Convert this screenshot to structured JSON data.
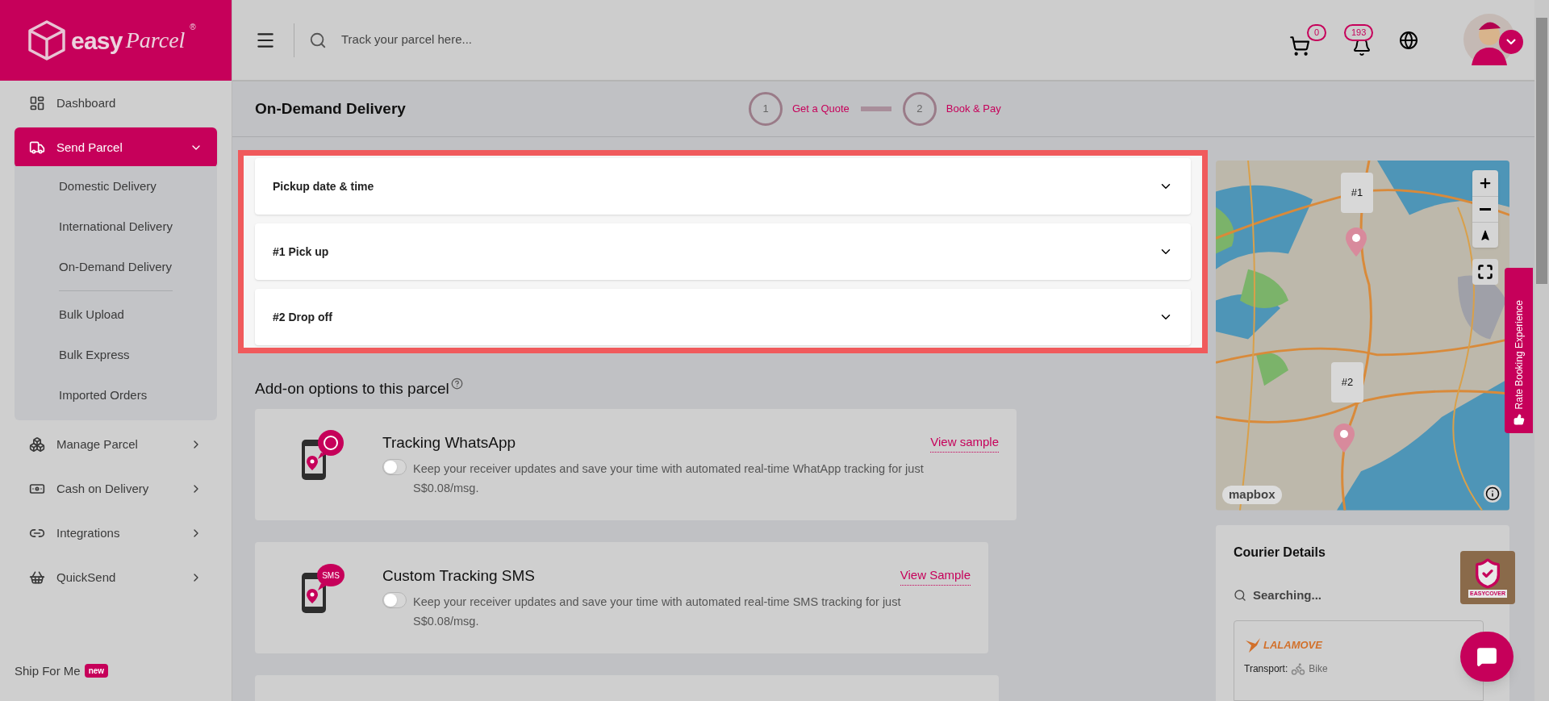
{
  "logo": {
    "word": "easy",
    "script": "Parcel",
    "mark": "®"
  },
  "topbar": {
    "search_placeholder": "Track your parcel here...",
    "cart_count": "0",
    "notification_count": "193"
  },
  "sidebar": {
    "items": [
      {
        "kind": "link",
        "label": "Dashboard",
        "selected": false
      },
      {
        "kind": "menu",
        "label": "Send Parcel",
        "selected": true,
        "expanded": true,
        "groups": [
          [
            {
              "label": "Domestic Delivery"
            },
            {
              "label": "International Delivery"
            },
            {
              "label": "On-Demand Delivery"
            }
          ],
          [
            {
              "label": "Bulk Upload"
            },
            {
              "label": "Bulk Express"
            },
            {
              "label": "Imported Orders"
            }
          ]
        ]
      },
      {
        "kind": "menu",
        "label": "Manage Parcel",
        "selected": false,
        "expanded": false
      },
      {
        "kind": "menu",
        "label": "Cash on Delivery",
        "selected": false,
        "expanded": false
      },
      {
        "kind": "menu",
        "label": "Integrations",
        "selected": false,
        "expanded": false
      },
      {
        "kind": "menu",
        "label": "QuickSend",
        "selected": false,
        "expanded": false
      }
    ],
    "footer": {
      "label": "Ship For Me",
      "badge": "new"
    }
  },
  "page": {
    "title": "On-Demand Delivery",
    "steps": [
      {
        "number": "1",
        "label": "Get a Quote"
      },
      {
        "number": "2",
        "label": "Book & Pay"
      }
    ]
  },
  "sections": [
    {
      "title": "Pickup date & time",
      "expanded": false
    },
    {
      "title": "#1 Pick up",
      "expanded": false
    },
    {
      "title": "#2 Drop off",
      "expanded": false
    }
  ],
  "addons": {
    "title": "Add-on options to this parcel",
    "items": [
      {
        "kind": "whatsapp",
        "title": "Tracking WhatsApp",
        "link": "View sample",
        "description": "Keep your receiver updates and save your time with automated real-time WhatApp tracking for just S$0.08/msg.",
        "on": false
      },
      {
        "kind": "sms",
        "icon_text": "SMS",
        "title": "Custom Tracking SMS",
        "link": "View Sample",
        "description": "Keep your receiver updates and save your time with automated real-time SMS tracking for just S$0.08/msg.",
        "on": false
      }
    ]
  },
  "map": {
    "markers": [
      {
        "label": "#1"
      },
      {
        "label": "#2"
      }
    ],
    "attribution": "mapbox"
  },
  "courier": {
    "title": "Courier Details",
    "status": "Searching...",
    "name": "LALAMOVE",
    "transport_label": "Transport:",
    "transport": "Bike"
  },
  "feedback_tab": "Rate Booking Experience",
  "easycover": "EASYCOVER"
}
